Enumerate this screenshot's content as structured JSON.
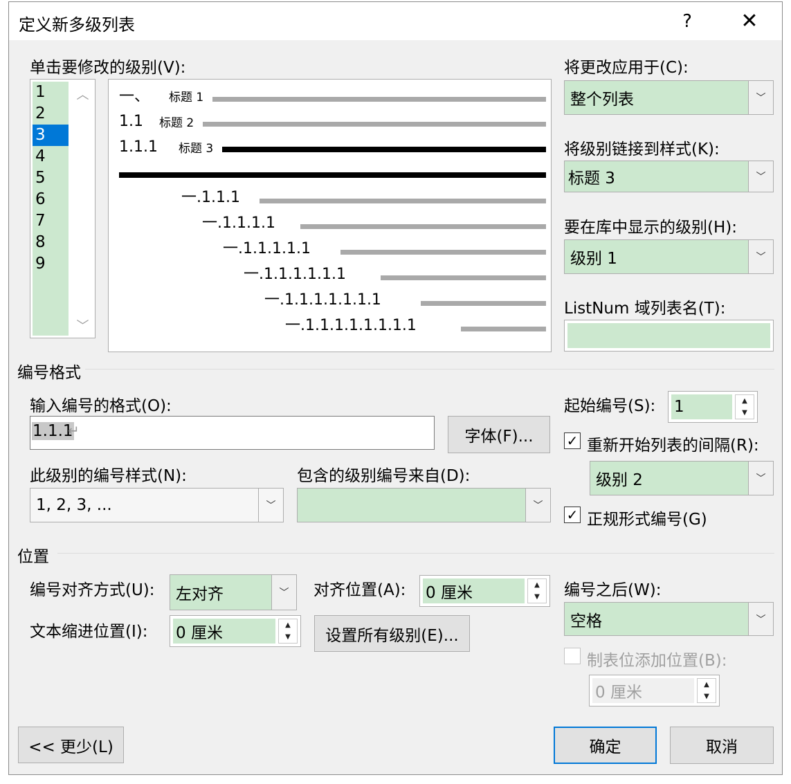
{
  "dialog": {
    "title": "定义新多级列表",
    "help": "?",
    "close": "✕"
  },
  "level_select": {
    "label": "单击要修改的级别(V):",
    "levels": [
      "1",
      "2",
      "3",
      "4",
      "5",
      "6",
      "7",
      "8",
      "9"
    ],
    "selected": "3"
  },
  "preview": {
    "rows": [
      {
        "number": "一、",
        "style": "标题 1"
      },
      {
        "number": "1.1",
        "style": "标题 2"
      },
      {
        "number": "1.1.1",
        "style": "标题 3"
      },
      {
        "number": "一.1.1.1"
      },
      {
        "number": "一.1.1.1.1"
      },
      {
        "number": "一.1.1.1.1.1"
      },
      {
        "number": "一.1.1.1.1.1.1"
      },
      {
        "number": "一.1.1.1.1.1.1.1"
      },
      {
        "number": "一.1.1.1.1.1.1.1.1"
      }
    ]
  },
  "right_panel": {
    "apply_to_label": "将更改应用于(C):",
    "apply_to_value": "整个列表",
    "link_style_label": "将级别链接到样式(K):",
    "link_style_value": "标题 3",
    "gallery_level_label": "要在库中显示的级别(H):",
    "gallery_level_value": "级别 1",
    "listnum_label": "ListNum 域列表名(T):",
    "listnum_value": ""
  },
  "number_format": {
    "section_label": "编号格式",
    "enter_format_label": "输入编号的格式(O):",
    "format_value": "1.1.1",
    "format_mark": "↵",
    "font_button": "字体(F)...",
    "style_label": "此级别的编号样式(N):",
    "style_value": "1, 2, 3, ...",
    "include_label": "包含的级别编号来自(D):",
    "include_value": "",
    "start_at_label": "起始编号(S):",
    "start_at_value": "1",
    "restart_label": "重新开始列表的间隔(R):",
    "restart_checked": true,
    "restart_value": "级别 2",
    "legal_label": "正规形式编号(G)",
    "legal_checked": true
  },
  "position": {
    "section_label": "位置",
    "alignment_label": "编号对齐方式(U):",
    "alignment_value": "左对齐",
    "aligned_at_label": "对齐位置(A):",
    "aligned_at_value": "0 厘米",
    "indent_label": "文本缩进位置(I):",
    "indent_value": "0 厘米",
    "set_all_button": "设置所有级别(E)...",
    "follow_label": "编号之后(W):",
    "follow_value": "空格",
    "tab_stop_label": "制表位添加位置(B):",
    "tab_stop_checked": false,
    "tab_stop_value": "0 厘米"
  },
  "footer": {
    "less_button": "<< 更少(L)",
    "ok_button": "确定",
    "cancel_button": "取消"
  },
  "checkmark": "✓"
}
